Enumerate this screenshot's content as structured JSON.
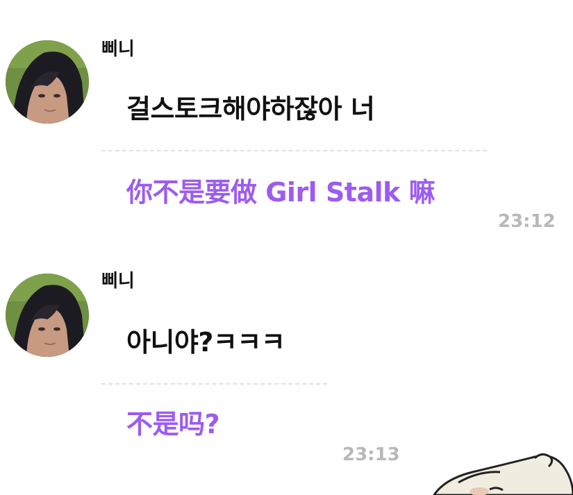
{
  "messages": [
    {
      "sender": "삐니",
      "original": "걸스토크해야하잖아 너",
      "translation": "你不是要做 Girl Stalk 嘛",
      "time": "23:12",
      "avatar_icon": "profile-photo-icon"
    },
    {
      "sender": "삐니",
      "original": "아니야?ㅋㅋㅋ",
      "translation": "不是吗?",
      "time": "23:13",
      "avatar_icon": "profile-photo-icon"
    }
  ],
  "colors": {
    "translation": "#9c5cf0",
    "timestamp": "#b8b8b8",
    "divider": "#e1e1e1",
    "text": "#111111"
  },
  "sticker_icon": "cartoon-sticker-icon"
}
